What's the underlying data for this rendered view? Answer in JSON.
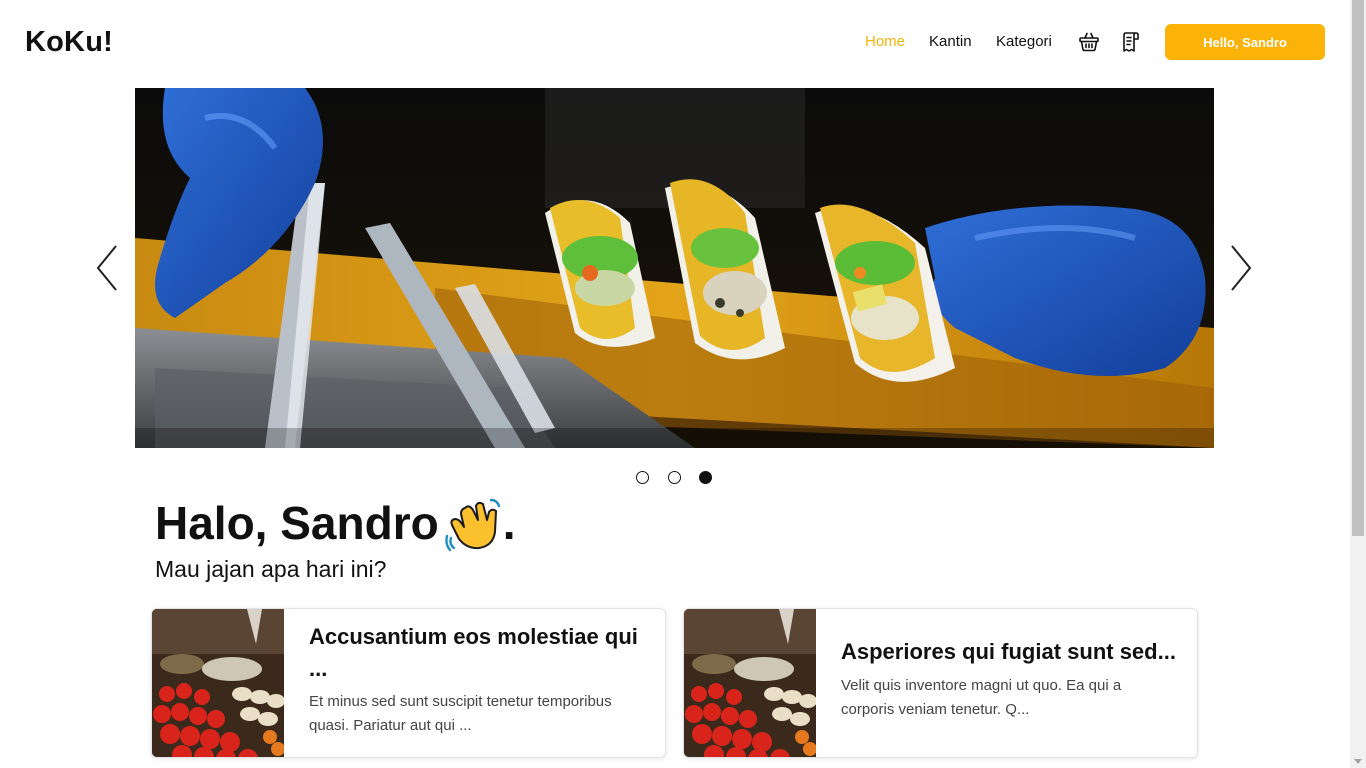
{
  "brand": "KoKu!",
  "nav": {
    "home": "Home",
    "kantin": "Kantin",
    "kategori": "Kategori",
    "basket_icon": "basket-icon",
    "receipt_icon": "receipt-icon",
    "user_button": "Hello, Sandro"
  },
  "colors": {
    "accent": "#fbb30a",
    "active_link": "#f5b50a"
  },
  "carousel": {
    "slide_count": 3,
    "active_slide": 3,
    "image_subject": "photo of tacos being served",
    "prev_icon": "chevron-left-icon",
    "next_icon": "chevron-right-icon"
  },
  "greeting": {
    "title": "Halo, Sandro",
    "emoji": "waving-hand-icon",
    "punctuation": ".",
    "subtitle": "Mau jajan apa hari ini?"
  },
  "cards": [
    {
      "title": "Accusantium eos molestiae qui ...",
      "text": "Et minus sed sunt suscipit tenetur temporibus quasi. Pariatur aut qui ..."
    },
    {
      "title": "Asperiores qui fugiat sunt sed...",
      "text": "Velit quis inventore magni ut quo. Ea qui a corporis veniam tenetur. Q..."
    }
  ]
}
